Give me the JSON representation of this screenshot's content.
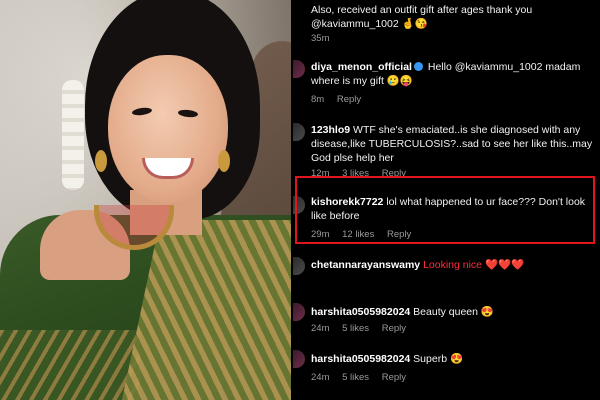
{
  "comments": [
    {
      "user": "",
      "text": "Also, received an outfit gift after ages thank you @kaviammu_1002 🤞😘",
      "time": "35m",
      "likes": "",
      "reply": ""
    },
    {
      "user": "diya_menon_official",
      "verified": true,
      "text": "Hello @kaviammu_1002 madam where is my gift 🥲😝",
      "time": "8m",
      "likes": "",
      "reply": "Reply"
    },
    {
      "user": "123hlo9",
      "text": "WTF she's emaciated..is she diagnosed with any disease,like TUBERCULOSIS?..sad to see her like this..may God plse help her",
      "time": "12m",
      "likes": "3 likes",
      "reply": "Reply"
    },
    {
      "user": "kishorekk7722",
      "text": "lol what happened to ur face??? Don't look like before",
      "time": "29m",
      "likes": "12 likes",
      "reply": "Reply",
      "highlighted": true
    },
    {
      "user": "chetannarayanswamy",
      "text": "Looking nice ❤️❤️❤️",
      "time": "",
      "likes": "",
      "reply": ""
    },
    {
      "user": "harshita0505982024",
      "text": "Beauty queen 😍",
      "time": "24m",
      "likes": "5 likes",
      "reply": "Reply"
    },
    {
      "user": "harshita0505982024",
      "text": "Superb 😍",
      "time": "24m",
      "likes": "5 likes",
      "reply": "Reply"
    }
  ],
  "colors": {
    "highlight": "#e0161c",
    "verified": "#3797f0",
    "meta": "#9a9a9a"
  }
}
